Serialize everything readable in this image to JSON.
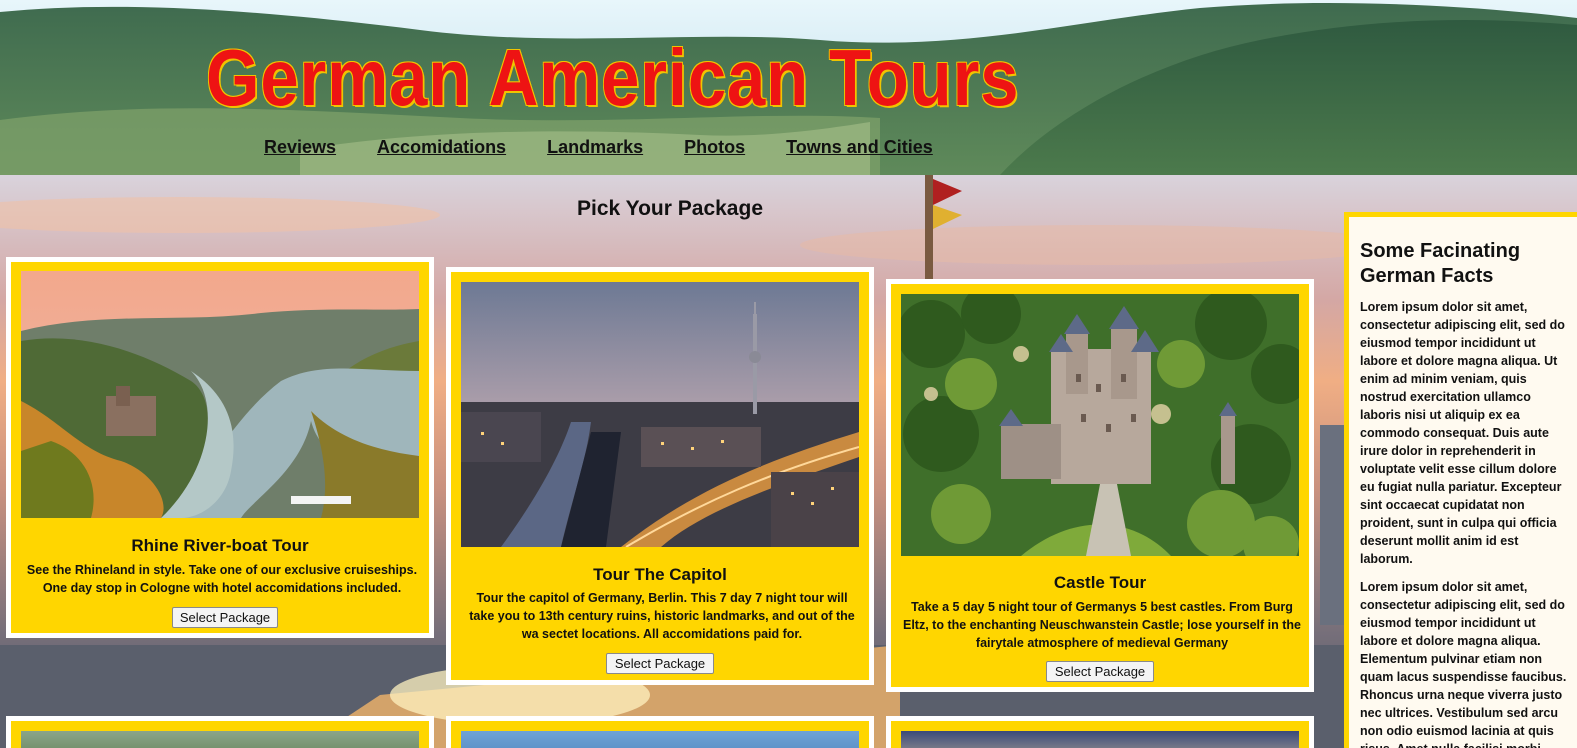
{
  "header": {
    "title": "German American Tours",
    "nav": [
      "Reviews",
      "Accomidations",
      "Landmarks",
      "Photos",
      "Towns and Cities"
    ]
  },
  "main": {
    "section_title": "Pick Your Package",
    "cards": [
      {
        "title": "Rhine River-boat Tour",
        "description": "See the Rhineland in style. Take one of our exclusive cruiseships. One day stop in Cologne with hotel accomidations included.",
        "button": "Select Package",
        "image": "rhine-river-photo"
      },
      {
        "title": "Tour The Capitol",
        "description": "Tour the capitol of Germany, Berlin. This 7 day 7 night tour will take you to 13th century ruins, historic landmarks, and out of the wa sectet locations. All accomidations paid for.",
        "button": "Select Package",
        "image": "berlin-photo"
      },
      {
        "title": "Castle Tour",
        "description": "Take a 5 day 5 night tour of Germanys 5 best castles. From Burg Eltz, to the enchanting Neuschwanstein Castle; lose yourself in the fairytale atmosphere of medieval Germany",
        "button": "Select Package",
        "image": "castle-photo"
      }
    ]
  },
  "facts": {
    "title": "Some Facinating German Facts",
    "paragraphs": [
      "Lorem ipsum dolor sit amet, consectetur adipiscing elit, sed do eiusmod tempor incididunt ut labore et dolore magna aliqua. Ut enim ad minim veniam, quis nostrud exercitation ullamco laboris nisi ut aliquip ex ea commodo consequat. Duis aute irure dolor in reprehenderit in voluptate velit esse cillum dolore eu fugiat nulla pariatur. Excepteur sint occaecat cupidatat non proident, sunt in culpa qui officia deserunt mollit anim id est laborum.",
      "Lorem ipsum dolor sit amet, consectetur adipiscing elit, sed do eiusmod tempor incididunt ut labore et dolore magna aliqua. Elementum pulvinar etiam non quam lacus suspendisse faucibus. Rhoncus urna neque viverra justo nec ultrices. Vestibulum sed arcu non odio euismod lacinia at quis risus. Amet nulla facilisi morbi tempus."
    ]
  },
  "colors": {
    "title_red": "#ee1313",
    "title_outline": "#f0c400",
    "card_yellow": "#ffd600",
    "facts_bg": "#fffaf0"
  }
}
